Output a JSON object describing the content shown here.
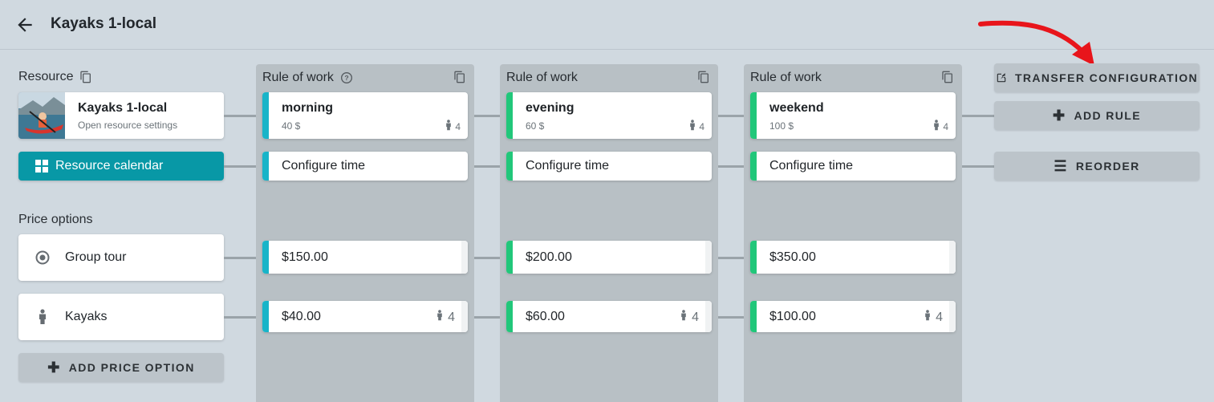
{
  "header": {
    "title": "Kayaks 1-local"
  },
  "resource": {
    "section_label": "Resource",
    "name": "Kayaks 1-local",
    "subtitle": "Open resource settings",
    "calendar_button": "Resource calendar"
  },
  "price_options": {
    "section_label": "Price options",
    "items": [
      {
        "label": "Group tour",
        "icon": "radio-target-icon"
      },
      {
        "label": "Kayaks",
        "icon": "person-icon"
      }
    ],
    "add_button": "ADD PRICE OPTION"
  },
  "columns": [
    {
      "heading": "Rule of work",
      "has_help": true,
      "accent": "#18b4c8",
      "rule_name": "morning",
      "rule_price": "40 $",
      "rule_capacity": "4",
      "time_label": "Configure time",
      "group_price": "$150.00",
      "kayak_price": "$40.00",
      "kayak_capacity": "4"
    },
    {
      "heading": "Rule of work",
      "has_help": false,
      "accent": "#21c77a",
      "rule_name": "evening",
      "rule_price": "60 $",
      "rule_capacity": "4",
      "time_label": "Configure time",
      "group_price": "$200.00",
      "kayak_price": "$60.00",
      "kayak_capacity": "4"
    },
    {
      "heading": "Rule of work",
      "has_help": false,
      "accent": "#21c77a",
      "rule_name": "weekend",
      "rule_price": "100 $",
      "rule_capacity": "4",
      "time_label": "Configure time",
      "group_price": "$350.00",
      "kayak_price": "$100.00",
      "kayak_capacity": "4"
    }
  ],
  "actions": {
    "transfer": "TRANSFER CONFIGURATION",
    "add_rule": "ADD RULE",
    "reorder": "REORDER"
  },
  "colors": {
    "background": "#d0d9e0",
    "primary": "#0898a6",
    "annotation_arrow": "#e8151b"
  }
}
